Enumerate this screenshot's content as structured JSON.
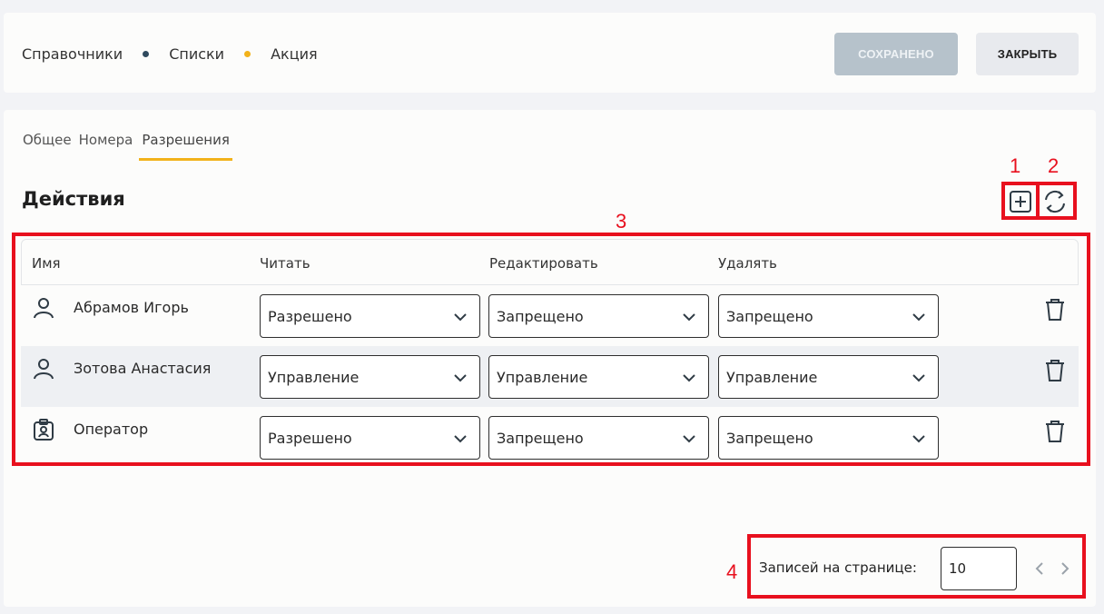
{
  "breadcrumb": {
    "items": [
      "Справочники",
      "Списки",
      "Акция"
    ],
    "dot_colors": [
      "#2f4a5e",
      "#f2b21a"
    ]
  },
  "header": {
    "saved_label": "СОХРАНЕНО",
    "close_label": "ЗАКРЫТЬ"
  },
  "tabs": [
    {
      "label": "Общее",
      "active": false
    },
    {
      "label": "Номера",
      "active": false
    },
    {
      "label": "Разрешения",
      "active": true
    }
  ],
  "section": {
    "title": "Действия",
    "add_icon": "plus-square-icon",
    "refresh_icon": "refresh-icon"
  },
  "table": {
    "columns": [
      "Имя",
      "Читать",
      "Редактировать",
      "Удалять"
    ],
    "rows": [
      {
        "icon": "user-icon",
        "name": "Абрамов Игорь",
        "read": "Разрешено",
        "edit": "Запрещено",
        "delete": "Запрещено"
      },
      {
        "icon": "user-icon",
        "name": "Зотова Анастасия",
        "read": "Управление",
        "edit": "Управление",
        "delete": "Управление"
      },
      {
        "icon": "badge-icon",
        "name": "Оператор",
        "read": "Разрешено",
        "edit": "Запрещено",
        "delete": "Запрещено"
      }
    ]
  },
  "pagination": {
    "label": "Записей на странице:",
    "page_size": "10"
  },
  "annotations": [
    "1",
    "2",
    "3",
    "4"
  ],
  "colors": {
    "accent": "#f2b21a",
    "annotation": "#e8101e",
    "saved_button": "#b6c2cb"
  }
}
